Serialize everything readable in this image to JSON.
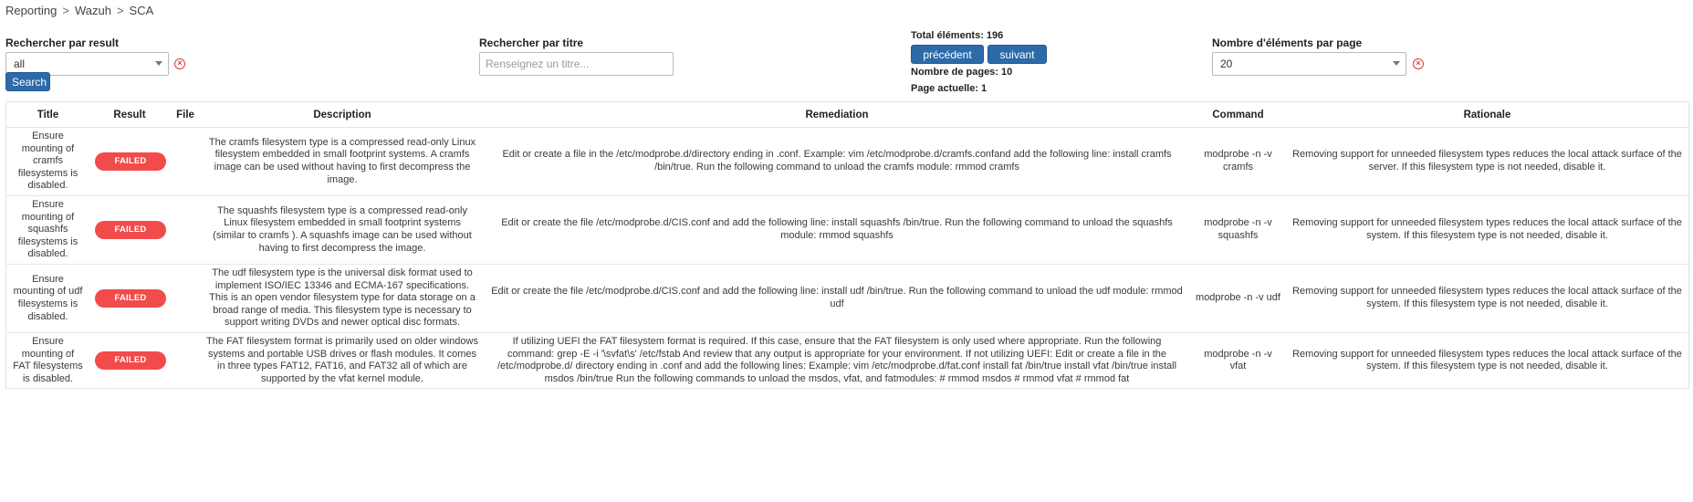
{
  "breadcrumb": [
    "Reporting",
    "Wazuh",
    "SCA"
  ],
  "breadcrumb_sep": ">",
  "filters": {
    "result_label": "Rechercher par result",
    "result_value": "all",
    "title_label": "Rechercher par titre",
    "title_placeholder": "Renseignez un titre...",
    "search_button": "Search",
    "per_page_label": "Nombre d'éléments par page",
    "per_page_value": "20"
  },
  "pagination": {
    "total_label": "Total éléments: 196",
    "prev_button": "précédent",
    "next_button": "suivant",
    "pages_label": "Nombre de pages: 10",
    "current_label": "Page actuelle: 1"
  },
  "table": {
    "headers": [
      "Title",
      "Result",
      "File",
      "Description",
      "Remediation",
      "Command",
      "Rationale"
    ],
    "rows": [
      {
        "title": "Ensure mounting of cramfs filesystems is disabled.",
        "result": "FAILED",
        "file": "",
        "description": "The cramfs filesystem type is a compressed read-only Linux filesystem embedded in small footprint systems. A cramfs image can be used without having to first decompress the image.",
        "remediation": "Edit or create a file in the /etc/modprobe.d/directory ending in .conf. Example: vim /etc/modprobe.d/cramfs.confand add the following line: install cramfs /bin/true. Run the following command to unload the cramfs module: rmmod cramfs",
        "command": "modprobe -n -v cramfs",
        "rationale": "Removing support for unneeded filesystem types reduces the local attack surface of the server. If this filesystem type is not needed, disable it."
      },
      {
        "title": "Ensure mounting of squashfs filesystems is disabled.",
        "result": "FAILED",
        "file": "",
        "description": "The squashfs filesystem type is a compressed read-only Linux filesystem embedded in small footprint systems (similar to cramfs ). A squashfs image can be used without having to first decompress the image.",
        "remediation": "Edit or create the file /etc/modprobe.d/CIS.conf and add the following line: install squashfs /bin/true. Run the following command to unload the squashfs module: rmmod squashfs",
        "command": "modprobe -n -v squashfs",
        "rationale": "Removing support for unneeded filesystem types reduces the local attack surface of the system. If this filesystem type is not needed, disable it."
      },
      {
        "title": "Ensure mounting of udf filesystems is disabled.",
        "result": "FAILED",
        "file": "",
        "description": "The udf filesystem type is the universal disk format used to implement ISO/IEC 13346 and ECMA-167 specifications. This is an open vendor filesystem type for data storage on a broad range of media. This filesystem type is necessary to support writing DVDs and newer optical disc formats.",
        "remediation": "Edit or create the file /etc/modprobe.d/CIS.conf and add the following line: install udf /bin/true. Run the following command to unload the udf module: rmmod udf",
        "command": "modprobe -n -v udf",
        "rationale": "Removing support for unneeded filesystem types reduces the local attack surface of the system. If this filesystem type is not needed, disable it."
      },
      {
        "title": "Ensure mounting of FAT filesystems is disabled.",
        "result": "FAILED",
        "file": "",
        "description": "The FAT filesystem format is primarily used on older windows systems and portable USB drives or flash modules. It comes in three types FAT12, FAT16, and FAT32 all of which are supported by the vfat kernel module.",
        "remediation": "If utilizing UEFI the FAT filesystem format is required. If this case, ensure that the FAT filesystem is only used where appropriate. Run the following command: grep -E -i '\\svfat\\s' /etc/fstab And review that any output is appropriate for your environment. If not utilizing UEFI: Edit or create a file in the /etc/modprobe.d/ directory ending in .conf and add the following lines: Example: vim /etc/modprobe.d/fat.conf install fat /bin/true install vfat /bin/true install msdos /bin/true Run the following commands to unload the msdos, vfat, and fatmodules: # rmmod msdos # rmmod vfat # rmmod fat",
        "command": "modprobe -n -v vfat",
        "rationale": "Removing support for unneeded filesystem types reduces the local attack surface of the system. If this filesystem type is not needed, disable it."
      }
    ]
  },
  "colors": {
    "primary_button": "#2c6aa8",
    "failed_badge": "#f24b4b",
    "clear_icon": "#d63b3b"
  },
  "icons": {
    "clear": "clear-circle-icon",
    "dropdown": "chevron-down-icon"
  }
}
